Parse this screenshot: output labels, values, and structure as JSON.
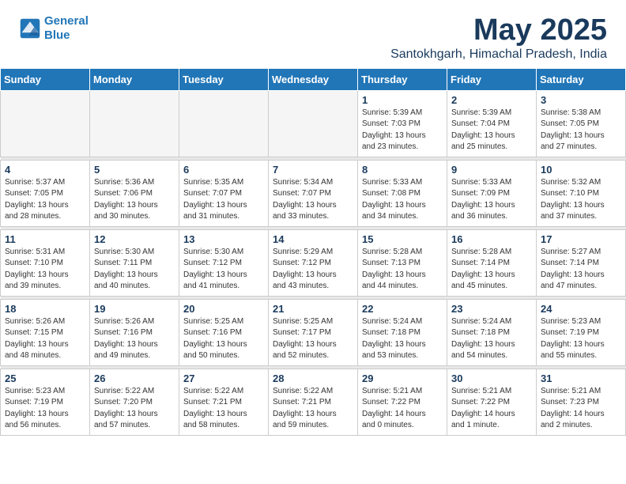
{
  "header": {
    "logo_line1": "General",
    "logo_line2": "Blue",
    "month": "May 2025",
    "location": "Santokhgarh, Himachal Pradesh, India"
  },
  "weekdays": [
    "Sunday",
    "Monday",
    "Tuesday",
    "Wednesday",
    "Thursday",
    "Friday",
    "Saturday"
  ],
  "weeks": [
    [
      {
        "day": "",
        "info": ""
      },
      {
        "day": "",
        "info": ""
      },
      {
        "day": "",
        "info": ""
      },
      {
        "day": "",
        "info": ""
      },
      {
        "day": "1",
        "info": "Sunrise: 5:39 AM\nSunset: 7:03 PM\nDaylight: 13 hours\nand 23 minutes."
      },
      {
        "day": "2",
        "info": "Sunrise: 5:39 AM\nSunset: 7:04 PM\nDaylight: 13 hours\nand 25 minutes."
      },
      {
        "day": "3",
        "info": "Sunrise: 5:38 AM\nSunset: 7:05 PM\nDaylight: 13 hours\nand 27 minutes."
      }
    ],
    [
      {
        "day": "4",
        "info": "Sunrise: 5:37 AM\nSunset: 7:05 PM\nDaylight: 13 hours\nand 28 minutes."
      },
      {
        "day": "5",
        "info": "Sunrise: 5:36 AM\nSunset: 7:06 PM\nDaylight: 13 hours\nand 30 minutes."
      },
      {
        "day": "6",
        "info": "Sunrise: 5:35 AM\nSunset: 7:07 PM\nDaylight: 13 hours\nand 31 minutes."
      },
      {
        "day": "7",
        "info": "Sunrise: 5:34 AM\nSunset: 7:07 PM\nDaylight: 13 hours\nand 33 minutes."
      },
      {
        "day": "8",
        "info": "Sunrise: 5:33 AM\nSunset: 7:08 PM\nDaylight: 13 hours\nand 34 minutes."
      },
      {
        "day": "9",
        "info": "Sunrise: 5:33 AM\nSunset: 7:09 PM\nDaylight: 13 hours\nand 36 minutes."
      },
      {
        "day": "10",
        "info": "Sunrise: 5:32 AM\nSunset: 7:10 PM\nDaylight: 13 hours\nand 37 minutes."
      }
    ],
    [
      {
        "day": "11",
        "info": "Sunrise: 5:31 AM\nSunset: 7:10 PM\nDaylight: 13 hours\nand 39 minutes."
      },
      {
        "day": "12",
        "info": "Sunrise: 5:30 AM\nSunset: 7:11 PM\nDaylight: 13 hours\nand 40 minutes."
      },
      {
        "day": "13",
        "info": "Sunrise: 5:30 AM\nSunset: 7:12 PM\nDaylight: 13 hours\nand 41 minutes."
      },
      {
        "day": "14",
        "info": "Sunrise: 5:29 AM\nSunset: 7:12 PM\nDaylight: 13 hours\nand 43 minutes."
      },
      {
        "day": "15",
        "info": "Sunrise: 5:28 AM\nSunset: 7:13 PM\nDaylight: 13 hours\nand 44 minutes."
      },
      {
        "day": "16",
        "info": "Sunrise: 5:28 AM\nSunset: 7:14 PM\nDaylight: 13 hours\nand 45 minutes."
      },
      {
        "day": "17",
        "info": "Sunrise: 5:27 AM\nSunset: 7:14 PM\nDaylight: 13 hours\nand 47 minutes."
      }
    ],
    [
      {
        "day": "18",
        "info": "Sunrise: 5:26 AM\nSunset: 7:15 PM\nDaylight: 13 hours\nand 48 minutes."
      },
      {
        "day": "19",
        "info": "Sunrise: 5:26 AM\nSunset: 7:16 PM\nDaylight: 13 hours\nand 49 minutes."
      },
      {
        "day": "20",
        "info": "Sunrise: 5:25 AM\nSunset: 7:16 PM\nDaylight: 13 hours\nand 50 minutes."
      },
      {
        "day": "21",
        "info": "Sunrise: 5:25 AM\nSunset: 7:17 PM\nDaylight: 13 hours\nand 52 minutes."
      },
      {
        "day": "22",
        "info": "Sunrise: 5:24 AM\nSunset: 7:18 PM\nDaylight: 13 hours\nand 53 minutes."
      },
      {
        "day": "23",
        "info": "Sunrise: 5:24 AM\nSunset: 7:18 PM\nDaylight: 13 hours\nand 54 minutes."
      },
      {
        "day": "24",
        "info": "Sunrise: 5:23 AM\nSunset: 7:19 PM\nDaylight: 13 hours\nand 55 minutes."
      }
    ],
    [
      {
        "day": "25",
        "info": "Sunrise: 5:23 AM\nSunset: 7:19 PM\nDaylight: 13 hours\nand 56 minutes."
      },
      {
        "day": "26",
        "info": "Sunrise: 5:22 AM\nSunset: 7:20 PM\nDaylight: 13 hours\nand 57 minutes."
      },
      {
        "day": "27",
        "info": "Sunrise: 5:22 AM\nSunset: 7:21 PM\nDaylight: 13 hours\nand 58 minutes."
      },
      {
        "day": "28",
        "info": "Sunrise: 5:22 AM\nSunset: 7:21 PM\nDaylight: 13 hours\nand 59 minutes."
      },
      {
        "day": "29",
        "info": "Sunrise: 5:21 AM\nSunset: 7:22 PM\nDaylight: 14 hours\nand 0 minutes."
      },
      {
        "day": "30",
        "info": "Sunrise: 5:21 AM\nSunset: 7:22 PM\nDaylight: 14 hours\nand 1 minute."
      },
      {
        "day": "31",
        "info": "Sunrise: 5:21 AM\nSunset: 7:23 PM\nDaylight: 14 hours\nand 2 minutes."
      }
    ]
  ]
}
